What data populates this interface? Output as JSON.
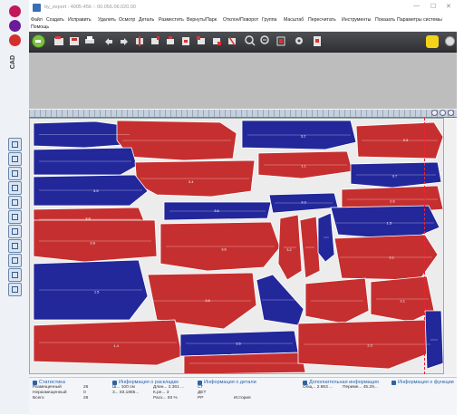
{
  "left_strip": {
    "cad_label": "CAD",
    "colors": {
      "pink": "#c2185b",
      "purple": "#6a1b9a",
      "red": "#d32f2f"
    }
  },
  "window": {
    "title": "by_export : 4005-456 :: 00.056.06.020.00",
    "controls": [
      "—",
      "☐",
      "✕"
    ]
  },
  "menu": {
    "items": [
      "Файл",
      "Создать",
      "Исправить",
      "Удалить",
      "Осмотр",
      "Деталь",
      "Разместить",
      "Вернуть/Парк",
      "Отклон/Поворот",
      "Группа",
      "Масштаб",
      "Пересчитать",
      "Инструменты",
      "Показать",
      "Параметры системы"
    ],
    "help": "Помощь"
  },
  "toolbar": {
    "icons": [
      "start-icon",
      "open-icon",
      "save-icon",
      "print-icon",
      "undo-icon",
      "redo-icon",
      "flip-icon",
      "rotate-icon",
      "move-icon",
      "align-icon",
      "group-icon",
      "ungroup-icon",
      "zoom-in-icon",
      "zoom-out-icon",
      "fit-icon",
      "settings-icon",
      "exit-icon"
    ]
  },
  "marker": {
    "colors": {
      "red": "#c62f2f",
      "blue": "#22279a",
      "background": "#ececec"
    },
    "piece_labels": [
      "3.2",
      "3.3",
      "3.4",
      "1.1",
      "3.7",
      "3.5",
      "3.8",
      "3.6",
      "3.3",
      "2.6",
      "1.5",
      "3.6",
      "3.6",
      "3.2",
      "3.1",
      "1.5",
      "3.8",
      "3.1",
      "1.4",
      "3.5",
      "2.2"
    ]
  },
  "panels": [
    {
      "title": "Статистика",
      "rows": [
        [
          "Размещенный",
          "26"
        ],
        [
          "Неразмещенный",
          "0"
        ],
        [
          "Всего",
          "26"
        ]
      ]
    },
    {
      "title": "Информация о раскладке",
      "rows": [
        [
          "Ш...  100 см",
          "Длин...  2.361 ..."
        ],
        [
          "3...  83.1865...",
          "К.ре...  3"
        ],
        [
          "",
          "Расх...  93 %"
        ]
      ]
    },
    {
      "title": "Информация о детали",
      "rows": [
        [
          "СТ",
          ""
        ],
        [
          "ДЕТ",
          ""
        ],
        [
          "РР",
          "История"
        ]
      ]
    },
    {
      "title": "Дополнительная информация",
      "rows": [
        [
          "Общ...  2.863 ...",
          "Периме...  45.29..."
        ]
      ]
    },
    {
      "title": "Информация о функции",
      "rows": []
    }
  ]
}
